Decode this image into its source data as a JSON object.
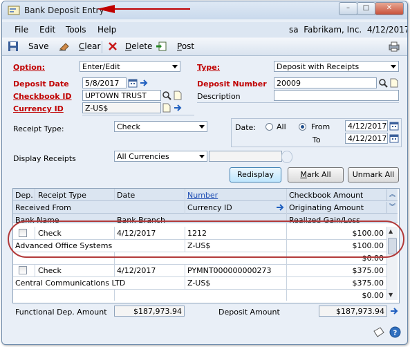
{
  "window": {
    "title": "Bank Deposit Entry"
  },
  "menu": {
    "items": [
      "File",
      "Edit",
      "Tools",
      "Help"
    ],
    "company_info": "sa  Fabrikam, Inc.  4/12/2017"
  },
  "toolbar": {
    "save": "Save",
    "clear": "Clear",
    "delete": "Delete",
    "post": "Post"
  },
  "form": {
    "option_label": "Option:",
    "option_value": "Enter/Edit",
    "type_label": "Type:",
    "type_value": "Deposit with Receipts",
    "deposit_date_label": "Deposit Date",
    "deposit_date_value": "5/8/2017",
    "deposit_number_label": "Deposit Number",
    "deposit_number_value": "20009",
    "checkbook_label": "Checkbook ID",
    "checkbook_value": "UPTOWN TRUST",
    "description_label": "Description",
    "description_value": "",
    "currency_label": "Currency ID",
    "currency_value": "Z-US$",
    "receipt_type_label": "Receipt Type:",
    "receipt_type_value": "Check",
    "date_label": "Date:",
    "date_all": "All",
    "date_from": "From",
    "date_to": "To",
    "date_from_value": "4/12/2017",
    "date_to_value": "4/12/2017",
    "display_receipts_label": "Display Receipts",
    "display_receipts_value": "All Currencies"
  },
  "buttons": {
    "redisplay": "Redisplay",
    "mark_all": "Mark All",
    "unmark_all": "Unmark All"
  },
  "grid": {
    "headers": {
      "dep": "Dep.",
      "receipt_type": "Receipt Type",
      "date": "Date",
      "number": "Number",
      "checkbook_amount": "Checkbook Amount",
      "received_from": "Received From",
      "currency_id": "Currency ID",
      "originating_amount": "Originating Amount",
      "bank_name": "Bank Name",
      "bank_branch": "Bank Branch",
      "realized": "Realized Gain/Loss"
    },
    "rows": [
      {
        "type": "Check",
        "date": "4/12/2017",
        "number": "1212",
        "checkbook_amount": "$100.00",
        "received_from": "Advanced Office Systems",
        "currency": "Z-US$",
        "originating_amount": "$100.00",
        "realized": "$0.00"
      },
      {
        "type": "Check",
        "date": "4/12/2017",
        "number": "PYMNT000000000273",
        "checkbook_amount": "$375.00",
        "received_from": "Central Communications LTD",
        "currency": "Z-US$",
        "originating_amount": "$375.00",
        "realized": "$0.00"
      }
    ]
  },
  "footer": {
    "functional_label": "Functional Dep. Amount",
    "functional_value": "$187,973.94",
    "deposit_amount_label": "Deposit Amount",
    "deposit_amount_value": "$187,973.94"
  },
  "colors": {
    "required_label": "#c00000",
    "annotation": "#c00000"
  },
  "icons": [
    "app-icon",
    "minimize-icon",
    "maximize-icon",
    "close-icon",
    "save-icon",
    "clear-icon",
    "delete-icon",
    "post-icon",
    "print-icon",
    "calendar-icon",
    "lookup-icon",
    "note-icon",
    "expand-arrow-icon",
    "scroll-up-icon",
    "scroll-down-icon",
    "help-icon"
  ]
}
